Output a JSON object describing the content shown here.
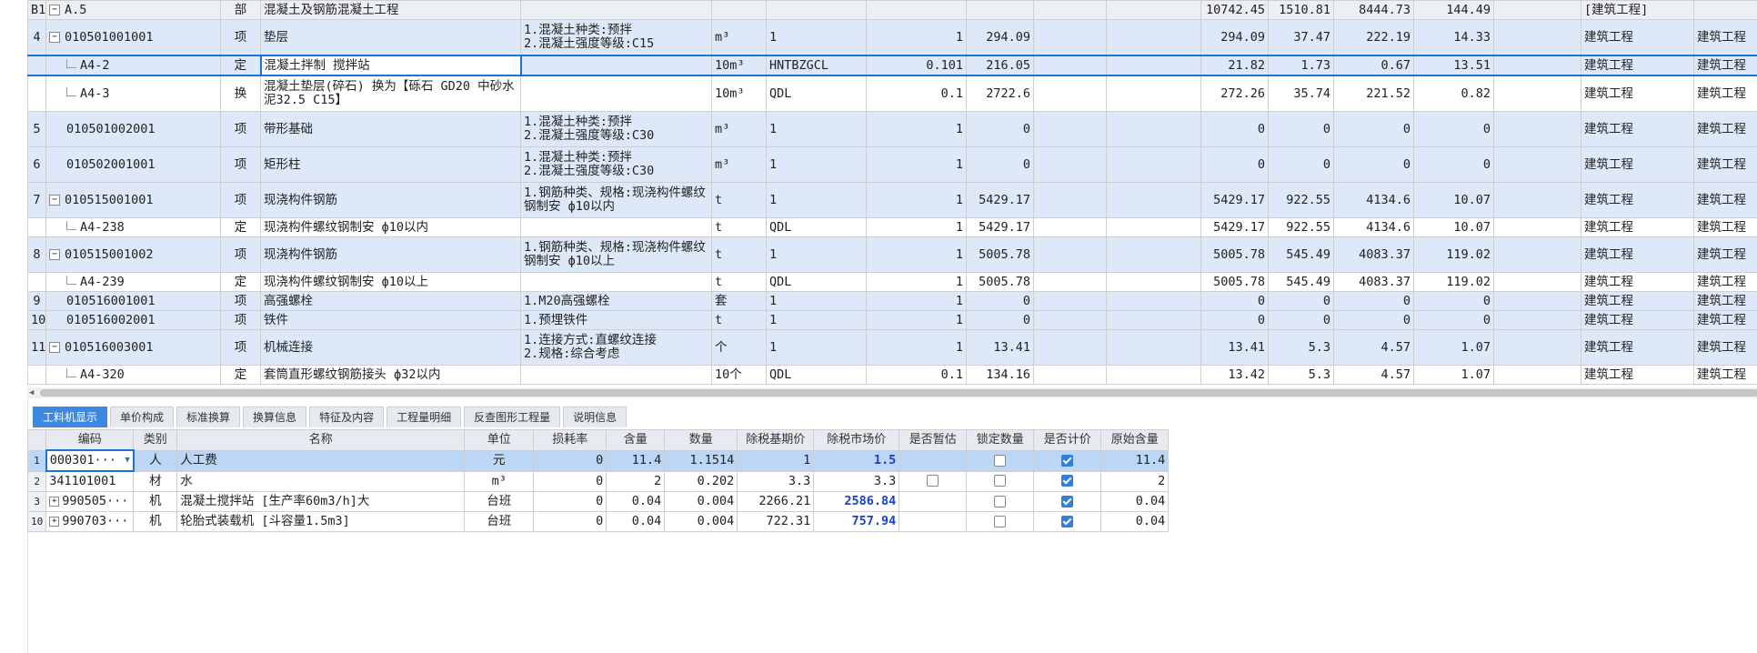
{
  "upper": {
    "rows": [
      {
        "cls": "grey h1",
        "no": "B1",
        "toggle": "-",
        "code": "A.5",
        "type": "部",
        "name": "混凝土及钢筋混凝土工程",
        "feature": "",
        "unit": "",
        "expr": "",
        "qty": "",
        "price": "",
        "c9": "",
        "c10": "",
        "total": "10742.45",
        "labor": "1510.81",
        "material": "8444.73",
        "machine": "144.49",
        "c15": "",
        "prof": "[建筑工程]",
        "prof2": ""
      },
      {
        "cls": "blue h2",
        "no": "4",
        "toggle": "-",
        "code": "010501001001",
        "type": "项",
        "name": "垫层",
        "feature": "1.混凝土种类:预拌\n2.混凝土强度等级:C15",
        "unit": "m³",
        "expr": "1",
        "qty": "1",
        "price": "294.09",
        "c9": "",
        "c10": "",
        "total": "294.09",
        "labor": "37.47",
        "material": "222.19",
        "machine": "14.33",
        "c15": "",
        "prof": "建筑工程",
        "prof2": "建筑工程"
      },
      {
        "cls": "blue h1 selected",
        "no": "",
        "toggle": "",
        "code": "A4-2",
        "child": true,
        "type": "定",
        "name": "混凝土拌制 搅拌站",
        "feature": "",
        "unit": "10m³",
        "expr": "HNTBZGCL",
        "qty": "0.101",
        "price": "216.05",
        "c9": "",
        "c10": "",
        "total": "21.82",
        "labor": "1.73",
        "material": "0.67",
        "machine": "13.51",
        "c15": "",
        "prof": "建筑工程",
        "prof2": "建筑工程"
      },
      {
        "cls": "white h2",
        "no": "",
        "toggle": "",
        "code": "A4-3",
        "child": true,
        "type": "换",
        "name": "混凝土垫层(碎石) 换为【砾石 GD20 中砂水泥32.5 C15】",
        "feature": "",
        "unit": "10m³",
        "expr": "QDL",
        "qty": "0.1",
        "price": "2722.6",
        "c9": "",
        "c10": "",
        "total": "272.26",
        "labor": "35.74",
        "material": "221.52",
        "machine": "0.82",
        "c15": "",
        "prof": "建筑工程",
        "prof2": "建筑工程"
      },
      {
        "cls": "blue h2",
        "no": "5",
        "toggle": "",
        "code": "010501002001",
        "type": "项",
        "name": "带形基础",
        "feature": "1.混凝土种类:预拌\n2.混凝土强度等级:C30",
        "unit": "m³",
        "expr": "1",
        "qty": "1",
        "price": "0",
        "c9": "",
        "c10": "",
        "total": "0",
        "labor": "0",
        "material": "0",
        "machine": "0",
        "c15": "",
        "prof": "建筑工程",
        "prof2": "建筑工程"
      },
      {
        "cls": "blue h2",
        "no": "6",
        "toggle": "",
        "code": "010502001001",
        "type": "项",
        "name": "矩形柱",
        "feature": "1.混凝土种类:预拌\n2.混凝土强度等级:C30",
        "unit": "m³",
        "expr": "1",
        "qty": "1",
        "price": "0",
        "c9": "",
        "c10": "",
        "total": "0",
        "labor": "0",
        "material": "0",
        "machine": "0",
        "c15": "",
        "prof": "建筑工程",
        "prof2": "建筑工程"
      },
      {
        "cls": "blue h2",
        "no": "7",
        "toggle": "-",
        "code": "010515001001",
        "type": "项",
        "name": "现浇构件钢筋",
        "feature": "1.钢筋种类、规格:现浇构件螺纹钢制安 ф10以内",
        "unit": "t",
        "expr": "1",
        "qty": "1",
        "price": "5429.17",
        "c9": "",
        "c10": "",
        "total": "5429.17",
        "labor": "922.55",
        "material": "4134.6",
        "machine": "10.07",
        "c15": "",
        "prof": "建筑工程",
        "prof2": "建筑工程"
      },
      {
        "cls": "white h1",
        "no": "",
        "toggle": "",
        "code": "A4-238",
        "child": true,
        "type": "定",
        "name": "现浇构件螺纹钢制安 ф10以内",
        "feature": "",
        "unit": "t",
        "expr": "QDL",
        "qty": "1",
        "price": "5429.17",
        "c9": "",
        "c10": "",
        "total": "5429.17",
        "labor": "922.55",
        "material": "4134.6",
        "machine": "10.07",
        "c15": "",
        "prof": "建筑工程",
        "prof2": "建筑工程"
      },
      {
        "cls": "blue h2",
        "no": "8",
        "toggle": "-",
        "code": "010515001002",
        "type": "项",
        "name": "现浇构件钢筋",
        "feature": "1.钢筋种类、规格:现浇构件螺纹钢制安 ф10以上",
        "unit": "t",
        "expr": "1",
        "qty": "1",
        "price": "5005.78",
        "c9": "",
        "c10": "",
        "total": "5005.78",
        "labor": "545.49",
        "material": "4083.37",
        "machine": "119.02",
        "c15": "",
        "prof": "建筑工程",
        "prof2": "建筑工程"
      },
      {
        "cls": "white h1",
        "no": "",
        "toggle": "",
        "code": "A4-239",
        "child": true,
        "type": "定",
        "name": "现浇构件螺纹钢制安 ф10以上",
        "feature": "",
        "unit": "t",
        "expr": "QDL",
        "qty": "1",
        "price": "5005.78",
        "c9": "",
        "c10": "",
        "total": "5005.78",
        "labor": "545.49",
        "material": "4083.37",
        "machine": "119.02",
        "c15": "",
        "prof": "建筑工程",
        "prof2": "建筑工程"
      },
      {
        "cls": "blue h1",
        "no": "9",
        "toggle": "",
        "code": "010516001001",
        "type": "项",
        "name": "高强螺栓",
        "feature": "1.M20高强螺栓",
        "unit": "套",
        "expr": "1",
        "qty": "1",
        "price": "0",
        "c9": "",
        "c10": "",
        "total": "0",
        "labor": "0",
        "material": "0",
        "machine": "0",
        "c15": "",
        "prof": "建筑工程",
        "prof2": "建筑工程"
      },
      {
        "cls": "blue h1",
        "no": "10",
        "toggle": "",
        "code": "010516002001",
        "type": "项",
        "name": "铁件",
        "feature": "1.预埋铁件",
        "unit": "t",
        "expr": "1",
        "qty": "1",
        "price": "0",
        "c9": "",
        "c10": "",
        "total": "0",
        "labor": "0",
        "material": "0",
        "machine": "0",
        "c15": "",
        "prof": "建筑工程",
        "prof2": "建筑工程"
      },
      {
        "cls": "blue h2",
        "no": "11",
        "toggle": "-",
        "code": "010516003001",
        "type": "项",
        "name": "机械连接",
        "feature": "1.连接方式:直螺纹连接\n2.规格:综合考虑",
        "unit": "个",
        "expr": "1",
        "qty": "1",
        "price": "13.41",
        "c9": "",
        "c10": "",
        "total": "13.41",
        "labor": "5.3",
        "material": "4.57",
        "machine": "1.07",
        "c15": "",
        "prof": "建筑工程",
        "prof2": "建筑工程"
      },
      {
        "cls": "white h1",
        "no": "",
        "toggle": "",
        "code": "A4-320",
        "child": true,
        "type": "定",
        "name": "套筒直形螺纹钢筋接头 ф32以内",
        "feature": "",
        "unit": "10个",
        "expr": "QDL",
        "qty": "0.1",
        "price": "134.16",
        "c9": "",
        "c10": "",
        "total": "13.42",
        "labor": "5.3",
        "material": "4.57",
        "machine": "1.07",
        "c15": "",
        "prof": "建筑工程",
        "prof2": "建筑工程"
      }
    ]
  },
  "tabs": [
    "工料机显示",
    "单价构成",
    "标准换算",
    "换算信息",
    "特征及内容",
    "工程量明细",
    "反查图形工程量",
    "说明信息"
  ],
  "lower": {
    "headers": [
      "",
      "编码",
      "类别",
      "名称",
      "单位",
      "损耗率",
      "含量",
      "数量",
      "除税基期价",
      "除税市场价",
      "是否暂估",
      "锁定数量",
      "是否计价",
      "原始含量"
    ],
    "rows": [
      {
        "rn": "1",
        "sel": true,
        "code": "000301···",
        "dd": true,
        "plus": false,
        "cat": "人",
        "name": "人工费",
        "unit": "元",
        "loss": "0",
        "content": "11.4",
        "qty": "1.1514",
        "base": "1",
        "market": "1.5",
        "mbold": true,
        "est": false,
        "lock": false,
        "price": true,
        "orig": "11.4"
      },
      {
        "rn": "2",
        "sel": false,
        "code": "341101001",
        "dd": false,
        "plus": false,
        "cat": "材",
        "name": "水",
        "unit": "m³",
        "loss": "0",
        "content": "2",
        "qty": "0.202",
        "base": "3.3",
        "market": "3.3",
        "mbold": false,
        "est": false,
        "estShow": true,
        "lock": false,
        "price": true,
        "orig": "2"
      },
      {
        "rn": "3",
        "sel": false,
        "code": "990505···",
        "dd": false,
        "plus": true,
        "cat": "机",
        "name": "混凝土搅拌站 [生产率60m3/h]大",
        "unit": "台班",
        "loss": "0",
        "content": "0.04",
        "qty": "0.004",
        "base": "2266.21",
        "market": "2586.84",
        "mbold": true,
        "est": false,
        "lock": false,
        "price": true,
        "orig": "0.04"
      },
      {
        "rn": "10",
        "sel": false,
        "code": "990703···",
        "dd": false,
        "plus": true,
        "cat": "机",
        "name": "轮胎式装载机 [斗容量1.5m3]",
        "unit": "台班",
        "loss": "0",
        "content": "0.04",
        "qty": "0.004",
        "base": "722.31",
        "market": "757.94",
        "mbold": true,
        "est": false,
        "lock": false,
        "price": true,
        "orig": "0.04"
      }
    ]
  }
}
